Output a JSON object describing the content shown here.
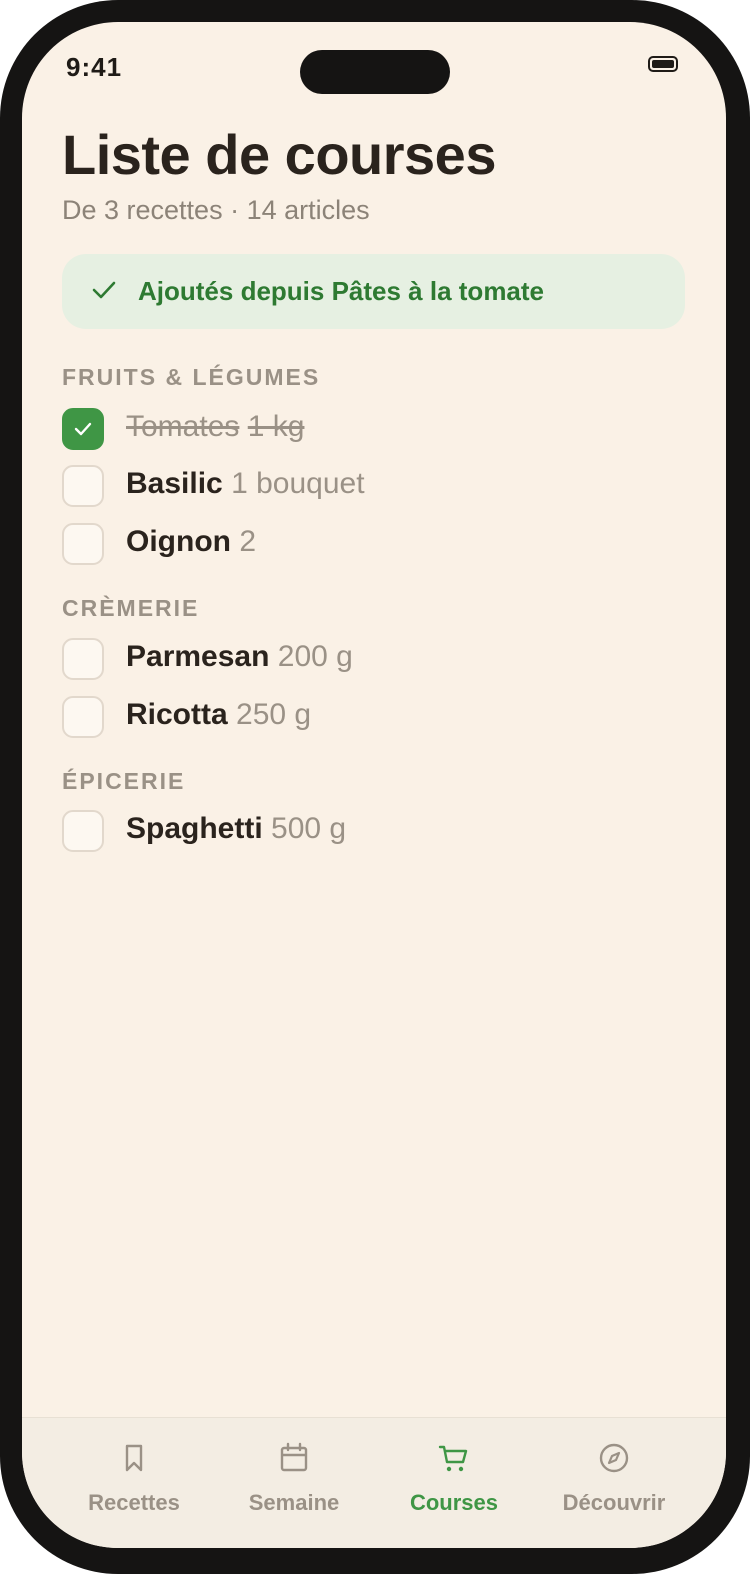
{
  "status_bar": {
    "time": "9:41"
  },
  "header": {
    "title": "Liste de courses",
    "subtitle": "De 3 recettes · 14 articles"
  },
  "banner": {
    "text": "Ajoutés depuis Pâtes à la tomate"
  },
  "sections": [
    {
      "title": "FRUITS & LÉGUMES",
      "items": [
        {
          "name": "Tomates",
          "qty": "1 kg",
          "checked": true
        },
        {
          "name": "Basilic",
          "qty": "1 bouquet",
          "checked": false
        },
        {
          "name": "Oignon",
          "qty": "2",
          "checked": false
        }
      ]
    },
    {
      "title": "CRÈMERIE",
      "items": [
        {
          "name": "Parmesan",
          "qty": "200 g",
          "checked": false
        },
        {
          "name": "Ricotta",
          "qty": "250 g",
          "checked": false
        }
      ]
    },
    {
      "title": "ÉPICERIE",
      "items": [
        {
          "name": "Spaghetti",
          "qty": "500 g",
          "checked": false
        }
      ]
    }
  ],
  "tabbar": {
    "active": "courses",
    "tabs": [
      {
        "id": "recettes",
        "label": "Recettes",
        "icon": "bookmark-icon"
      },
      {
        "id": "semaine",
        "label": "Semaine",
        "icon": "calendar-icon"
      },
      {
        "id": "courses",
        "label": "Courses",
        "icon": "cart-icon"
      },
      {
        "id": "decouvrir",
        "label": "Découvrir",
        "icon": "compass-icon"
      }
    ]
  },
  "colors": {
    "background": "#faf1e6",
    "accent": "#3f9645",
    "banner_background": "#e6f0e2",
    "text_primary": "#2a231d",
    "text_muted": "#9a9186"
  }
}
